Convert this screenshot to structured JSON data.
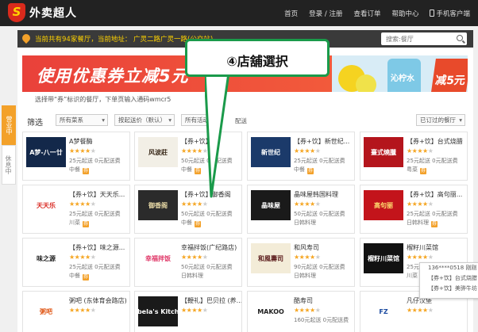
{
  "header": {
    "logo_mark": "S",
    "logo_text": "外卖超人",
    "nav": [
      "首页",
      "登录 / 注册",
      "查看订单",
      "帮助中心",
      "手机客户端"
    ]
  },
  "location": {
    "text": "当前共有94家餐厅，当前地址：  广灵二路广灵一路(公交站)",
    "search_placeholder": "搜索:餐厅"
  },
  "banner": {
    "title": "使用优惠券立减5元",
    "subtitle": "选择带“券”标识的餐厅，下单页输入通码wmcr5",
    "drink_text": "沁柠水",
    "badge": "减5元"
  },
  "filter": {
    "label": "筛选",
    "selects": [
      "所有菜系",
      "按起送价（默认）",
      "所有活动"
    ],
    "plain": "配送",
    "right_select": "已订过的餐厅"
  },
  "side_tabs": [
    "营业中",
    "休息中"
  ],
  "callout": {
    "text": "④店舖選択"
  },
  "popup": {
    "lines": [
      "136****0518 刚刚",
      "【券+饮】台式烧腊",
      "【券+饮】美骅牛坊"
    ]
  },
  "restaurants": [
    {
      "name": "A梦餐酶",
      "stars": 4,
      "min": "25元起送",
      "fee": "0元配送费",
      "cat": "中餐",
      "quan": true,
      "thumb": "A梦-八一廿",
      "thumb_bg": "#13284a",
      "thumb_fg": "#ffffff"
    },
    {
      "name": "【券+饮】",
      "stars": 4,
      "min": "50元起送",
      "fee": "0元配送费",
      "cat": "中餐",
      "quan": true,
      "thumb": "风波莊",
      "thumb_bg": "#f2efe6",
      "thumb_fg": "#3a2a1a"
    },
    {
      "name": "【券+饮】新世纪...",
      "stars": 4,
      "min": "25元起送",
      "fee": "0元配送费",
      "cat": "中餐",
      "quan": true,
      "thumb": "新世纪",
      "thumb_bg": "#1b3a6a",
      "thumb_fg": "#ffffff"
    },
    {
      "name": "【券+饮】台式烧腊",
      "stars": 4,
      "min": "25元起送",
      "fee": "0元配送费",
      "cat": "粤菜",
      "quan": true,
      "thumb": "臺式燒臘",
      "thumb_bg": "#b4151c",
      "thumb_fg": "#ffffff"
    },
    {
      "name": "【券+饮】天天乐...",
      "stars": 4,
      "min": "25元起送",
      "fee": "0元配送费",
      "cat": "川菜",
      "quan": true,
      "thumb": "天天乐",
      "thumb_bg": "#ffffff",
      "thumb_fg": "#d8241c"
    },
    {
      "name": "【券+饮】御香阁",
      "stars": 4,
      "min": "50元起送",
      "fee": "0元配送费",
      "cat": "中餐",
      "quan": true,
      "thumb": "御香阁",
      "thumb_bg": "#2b2b2b",
      "thumb_fg": "#e8d9a6"
    },
    {
      "name": "晶味屋韩国料理",
      "stars": 4,
      "min": "50元起送",
      "fee": "0元配送费",
      "cat": "日韩料理",
      "quan": false,
      "thumb": "晶味屋",
      "thumb_bg": "#1a1a1a",
      "thumb_fg": "#ffffff"
    },
    {
      "name": "【券+饮】高句丽...",
      "stars": 4,
      "min": "25元起送",
      "fee": "0元配送费",
      "cat": "日韩料理",
      "quan": true,
      "thumb": "高句丽",
      "thumb_bg": "#c3141b",
      "thumb_fg": "#ffe070"
    },
    {
      "name": "【券+饮】味之源...",
      "stars": 4,
      "min": "25元起送",
      "fee": "0元配送费",
      "cat": "中餐",
      "quan": true,
      "thumb": "味之源",
      "thumb_bg": "#ffffff",
      "thumb_fg": "#222222"
    },
    {
      "name": "幸福拌饭(广纪路店)",
      "stars": 4,
      "min": "50元起送",
      "fee": "0元配送费",
      "cat": "日韩料理",
      "quan": false,
      "thumb": "幸福拌饭",
      "thumb_bg": "#ffffff",
      "thumb_fg": "#e03a6a"
    },
    {
      "name": "和风寿司",
      "stars": 4,
      "min": "90元起送",
      "fee": "0元配送费",
      "cat": "日韩料理",
      "quan": false,
      "thumb": "和風壽司",
      "thumb_bg": "#f3ecd8",
      "thumb_fg": "#5a1a1a"
    },
    {
      "name": "榴籽川菜馆",
      "stars": 4,
      "min": "25元起送",
      "fee": "0元配送费",
      "cat": "川菜",
      "quan": true,
      "thumb": "榴籽川菜馆",
      "thumb_bg": "#111111",
      "thumb_fg": "#ffffff"
    },
    {
      "name": "粥吧 (东体育会路店)",
      "stars": 4,
      "min": "",
      "fee": "",
      "cat": "",
      "quan": false,
      "thumb": "粥吧",
      "thumb_bg": "#ffffff",
      "thumb_fg": "#e05a1a"
    },
    {
      "name": "【鞭礼】巴贝拉 (养...",
      "stars": 4,
      "min": "",
      "fee": "",
      "cat": "",
      "quan": false,
      "thumb": "Babela's Kitchen",
      "thumb_bg": "#1a1a1a",
      "thumb_fg": "#ffffff"
    },
    {
      "name": "酷寿司",
      "stars": 4,
      "min": "160元起送",
      "fee": "0元配送费",
      "cat": "",
      "quan": false,
      "thumb": "MAKOO",
      "thumb_bg": "#ffffff",
      "thumb_fg": "#222222"
    },
    {
      "name": "凡仔汉堡",
      "stars": 4,
      "min": "",
      "fee": "",
      "cat": "",
      "quan": false,
      "thumb": "FZ",
      "thumb_bg": "#ffffff",
      "thumb_fg": "#1a4aa0"
    }
  ]
}
